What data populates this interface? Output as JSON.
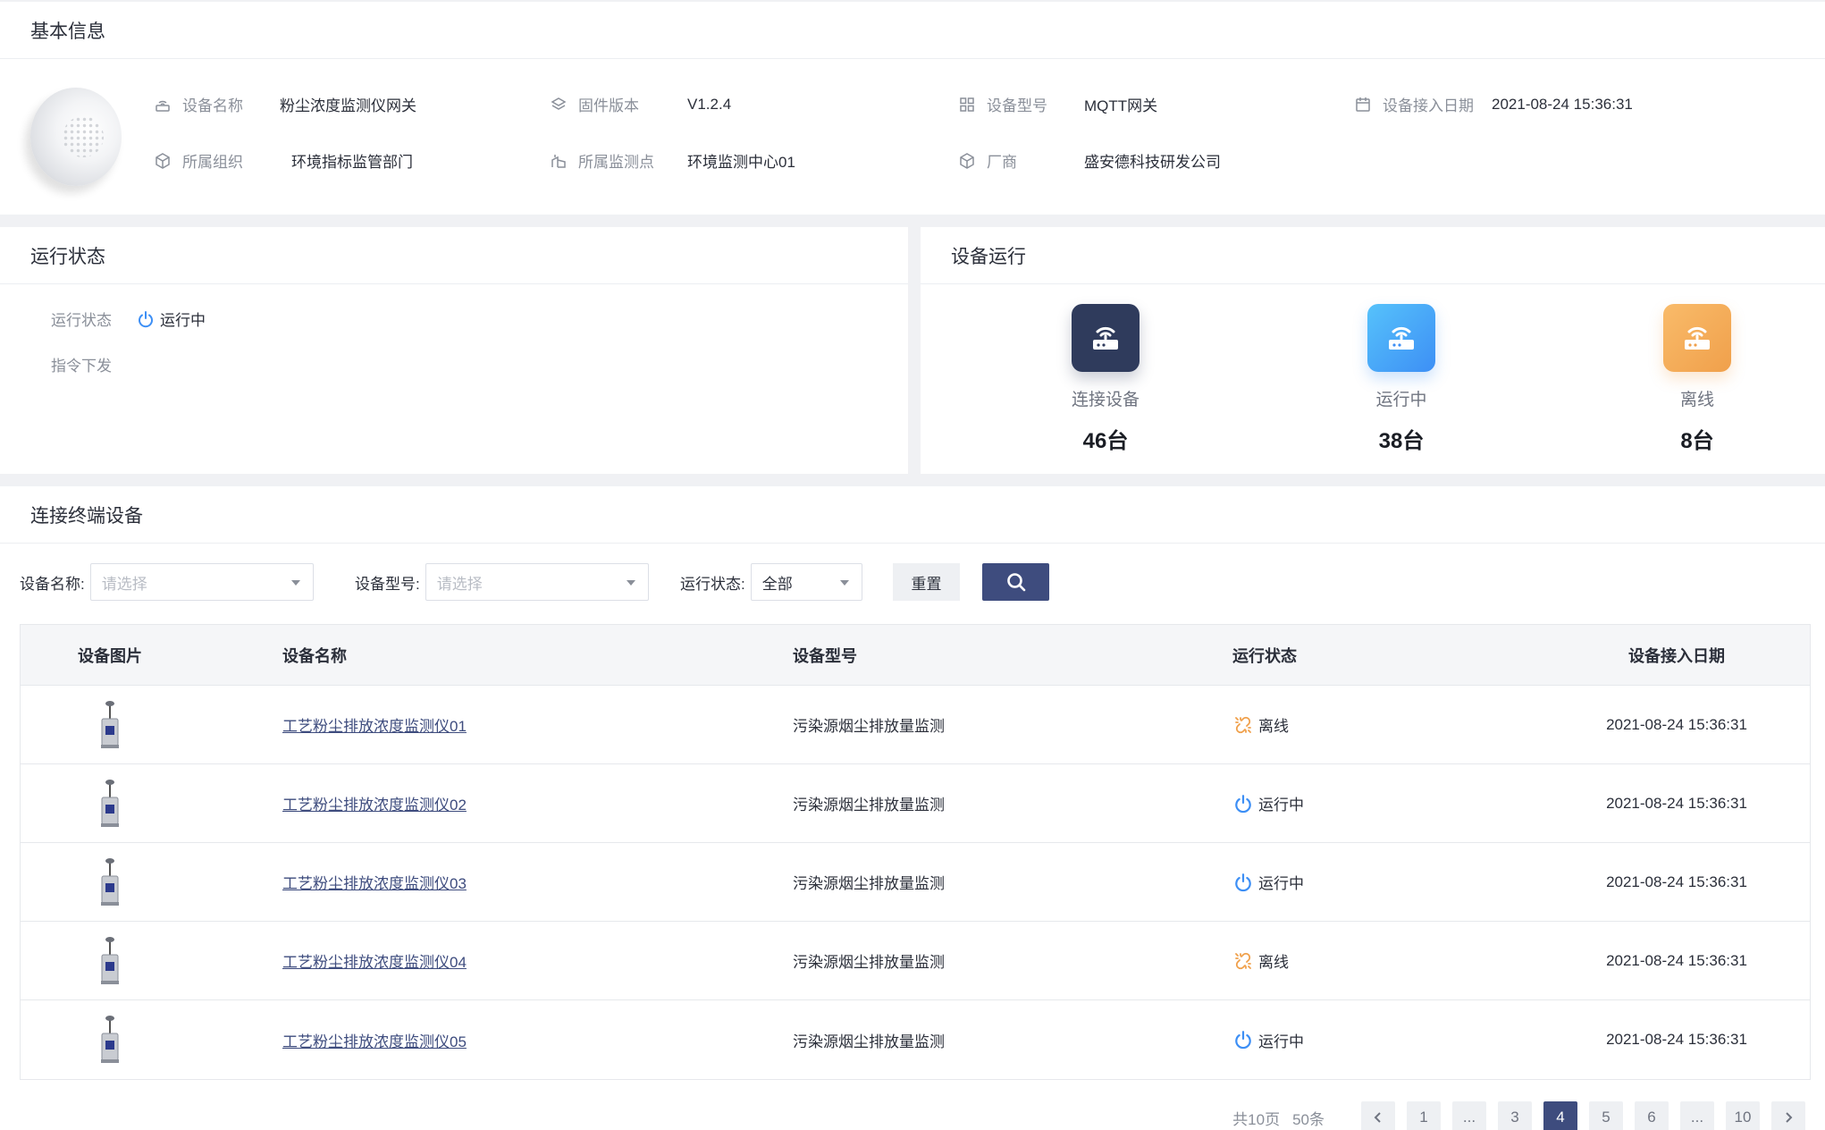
{
  "basic": {
    "title": "基本信息",
    "fields": {
      "name": {
        "label": "设备名称",
        "value": "粉尘浓度监测仪网关"
      },
      "firmware": {
        "label": "固件版本",
        "value": "V1.2.4"
      },
      "model": {
        "label": "设备型号",
        "value": "MQTT网关"
      },
      "date": {
        "label": "设备接入日期",
        "value": "2021-08-24 15:36:31"
      },
      "org": {
        "label": "所属组织",
        "value": "环境指标监管部门"
      },
      "site": {
        "label": "所属监测点",
        "value": "环境监测中心01"
      },
      "vendor": {
        "label": "厂商",
        "value": "盛安德科技研发公司"
      }
    }
  },
  "status": {
    "title": "运行状态",
    "run_label": "运行状态",
    "run_value": "运行中",
    "cmd_label": "指令下发"
  },
  "run": {
    "title": "设备运行",
    "stats": [
      {
        "label": "连接设备",
        "value": "46台",
        "color": "#2f3b5c"
      },
      {
        "label": "运行中",
        "value": "38台",
        "color": "#3d8ff5"
      },
      {
        "label": "离线",
        "value": "8台",
        "color": "#f0a04b"
      }
    ]
  },
  "terminals": {
    "title": "连接终端设备",
    "filters": {
      "name_label": "设备名称:",
      "name_placeholder": "请选择",
      "model_label": "设备型号:",
      "model_placeholder": "请选择",
      "status_label": "运行状态:",
      "status_value": "全部"
    },
    "reset_label": "重置",
    "columns": [
      "设备图片",
      "设备名称",
      "设备型号",
      "运行状态",
      "设备接入日期"
    ],
    "rows": [
      {
        "name": "工艺粉尘排放浓度监测仪01",
        "model": "污染源烟尘排放量监测",
        "status": "离线",
        "date": "2021-08-24 15:36:31"
      },
      {
        "name": "工艺粉尘排放浓度监测仪02",
        "model": "污染源烟尘排放量监测",
        "status": "运行中",
        "date": "2021-08-24 15:36:31"
      },
      {
        "name": "工艺粉尘排放浓度监测仪03",
        "model": "污染源烟尘排放量监测",
        "status": "运行中",
        "date": "2021-08-24 15:36:31"
      },
      {
        "name": "工艺粉尘排放浓度监测仪04",
        "model": "污染源烟尘排放量监测",
        "status": "离线",
        "date": "2021-08-24 15:36:31"
      },
      {
        "name": "工艺粉尘排放浓度监测仪05",
        "model": "污染源烟尘排放量监测",
        "status": "运行中",
        "date": "2021-08-24 15:36:31"
      }
    ],
    "pagination": {
      "total_pages": "共10页",
      "total_items": "50条",
      "pages": [
        "1",
        "...",
        "3",
        "4",
        "5",
        "6",
        "...",
        "10"
      ],
      "current": "4"
    }
  },
  "colors": {
    "accent": "#3e4c7e",
    "running": "#3d8ff5",
    "offline": "#f0a04b"
  }
}
